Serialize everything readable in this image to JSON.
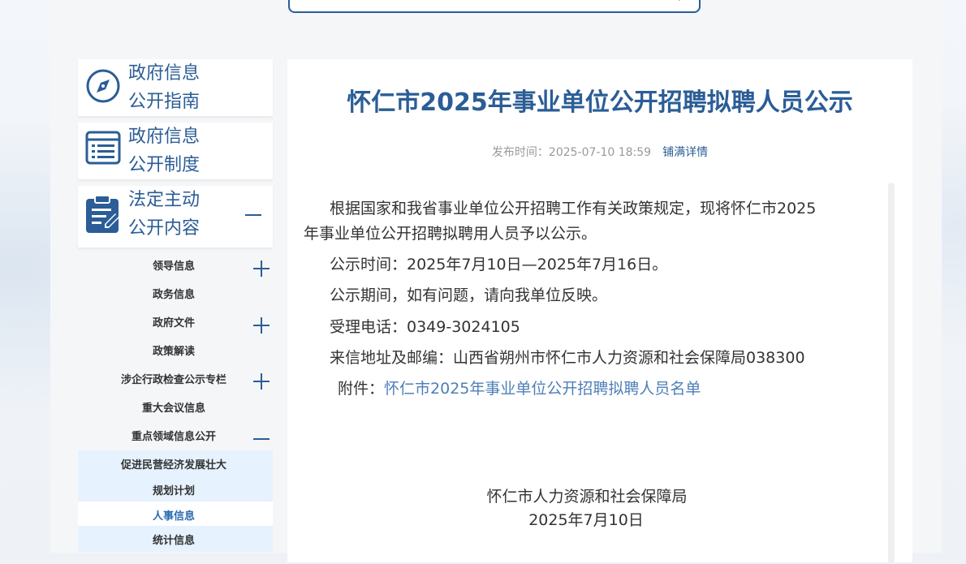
{
  "sidebar": {
    "blocks": [
      {
        "line1": "政府信息",
        "line2": "公开指南",
        "icon": "compass-icon"
      },
      {
        "line1": "政府信息",
        "line2": "公开制度",
        "icon": "list-icon"
      },
      {
        "line1": "法定主动",
        "line2": "公开内容",
        "icon": "clipboard-icon"
      }
    ],
    "items": [
      {
        "label": "领导信息",
        "expander": "plus"
      },
      {
        "label": "政务信息",
        "expander": ""
      },
      {
        "label": "政府文件",
        "expander": "plus"
      },
      {
        "label": "政策解读",
        "expander": ""
      },
      {
        "label": "涉企行政检查公示专栏",
        "expander": "plus"
      },
      {
        "label": "重大会议信息",
        "expander": ""
      },
      {
        "label": "重点领域信息公开",
        "expander": "minus"
      },
      {
        "label": "促进民营经济发展壮大",
        "expander": ""
      },
      {
        "label": "规划计划",
        "expander": ""
      },
      {
        "label": "人事信息",
        "expander": "",
        "active": true
      },
      {
        "label": "统计信息",
        "expander": ""
      }
    ]
  },
  "article": {
    "title": "怀仁市2025年事业单位公开招聘拟聘人员公示",
    "publish_label": "发布时间：",
    "publish_time": "2025-07-10 18:59",
    "full_detail": "铺满详情",
    "intro_line1": "根据国家和我省事业单位公开招聘工作有关政策规定，现将怀仁市2025",
    "intro_line2": "年事业单位公开招聘拟聘用人员予以公示。",
    "period": "公示时间：2025年7月10日—2025年7月16日。",
    "notice": "公示期间，如有问题，请向我单位反映。",
    "phone": "受理电话：0349-3024105",
    "address": "来信地址及邮编：山西省朔州市怀仁市人力资源和社会保障局038300",
    "attachment_label": "附件：",
    "attachment_link": "怀仁市2025年事业单位公开招聘拟聘人员名单",
    "signature_org": "怀仁市人力资源和社会保障局",
    "signature_date": "2025年7月10日"
  },
  "colors": {
    "accent": "#2b5d96",
    "link": "#4d7fb8",
    "highlight": "#e6f2fd"
  }
}
